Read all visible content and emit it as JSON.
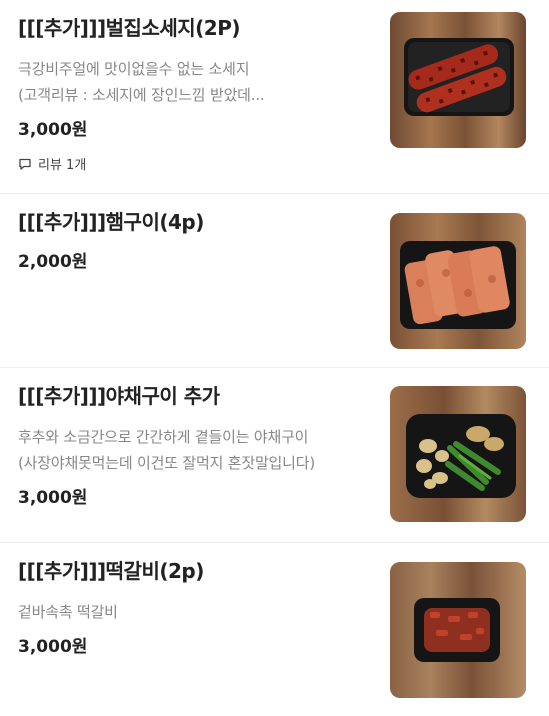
{
  "menu": {
    "items": [
      {
        "title": "[[[추가]]]벌집소세지(2P)",
        "description_lines": [
          "극강비주얼에 맛이없을수 없는 소세지",
          "(고객리뷰 : 소세지에 장인느낌 받았데..."
        ],
        "price": "3,000원",
        "review": "리뷰 1개",
        "image_icon": "sausage-food-photo"
      },
      {
        "title": "[[[추가]]]햄구이(4p)",
        "price": "2,000원",
        "image_icon": "grilled-ham-food-photo"
      },
      {
        "title": "[[[추가]]]야채구이 추가",
        "description_lines": [
          "후추와 소금간으로 간간하게 곁들이는 야채구이",
          "(사장야채못먹는데 이건또 잘먹지 혼잣말입니다)"
        ],
        "price": "3,000원",
        "image_icon": "grilled-vegetables-food-photo"
      },
      {
        "title": "[[[추가]]]떡갈비(2p)",
        "description_lines": [
          "겉바속촉 떡갈비"
        ],
        "price": "3,000원",
        "image_icon": "tteokgalbi-food-photo"
      }
    ]
  },
  "colors": {
    "price": "#222222",
    "description": "#888888",
    "divider": "#eeeeee",
    "wood": "#8a5a3b"
  }
}
